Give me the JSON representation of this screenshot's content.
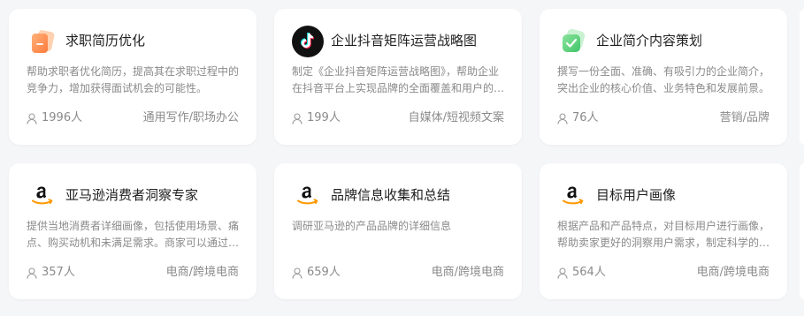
{
  "cards": [
    {
      "title": "求职简历优化",
      "description": "帮助求职者优化简历，提高其在求职过程中的竞争力，增加获得面试机会的可能性。",
      "users": "1996人",
      "category": "通用写作/职场办公",
      "icon": "resume-icon"
    },
    {
      "title": "企业抖音矩阵运营战略图",
      "description": "制定《企业抖音矩阵运营战略图》，帮助企业在抖音平台上实现品牌的全面覆盖和用户的精准触达。",
      "users": "199人",
      "category": "自媒体/短视频文案",
      "icon": "tiktok-icon"
    },
    {
      "title": "企业简介内容策划",
      "description": "撰写一份全面、准确、有吸引力的企业简介，突出企业的核心价值、业务特色和发展前景。",
      "users": "76人",
      "category": "营销/品牌",
      "icon": "check-badge-icon"
    },
    {
      "title": "亚马逊消费者洞察专家",
      "description": "提供当地消费者详细画像，包括使用场景、痛点、购买动机和未满足需求。商家可以通过这些信息调整策略。",
      "users": "357人",
      "category": "电商/跨境电商",
      "icon": "amazon-icon"
    },
    {
      "title": "品牌信息收集和总结",
      "description": "调研亚马逊的产品品牌的详细信息",
      "users": "659人",
      "category": "电商/跨境电商",
      "icon": "amazon-icon"
    },
    {
      "title": "目标用户画像",
      "description": "根据产品和产品特点，对目标用户进行画像，帮助卖家更好的洞察用户需求，制定科学的营销策略。",
      "users": "564人",
      "category": "电商/跨境电商",
      "icon": "amazon-icon"
    }
  ]
}
